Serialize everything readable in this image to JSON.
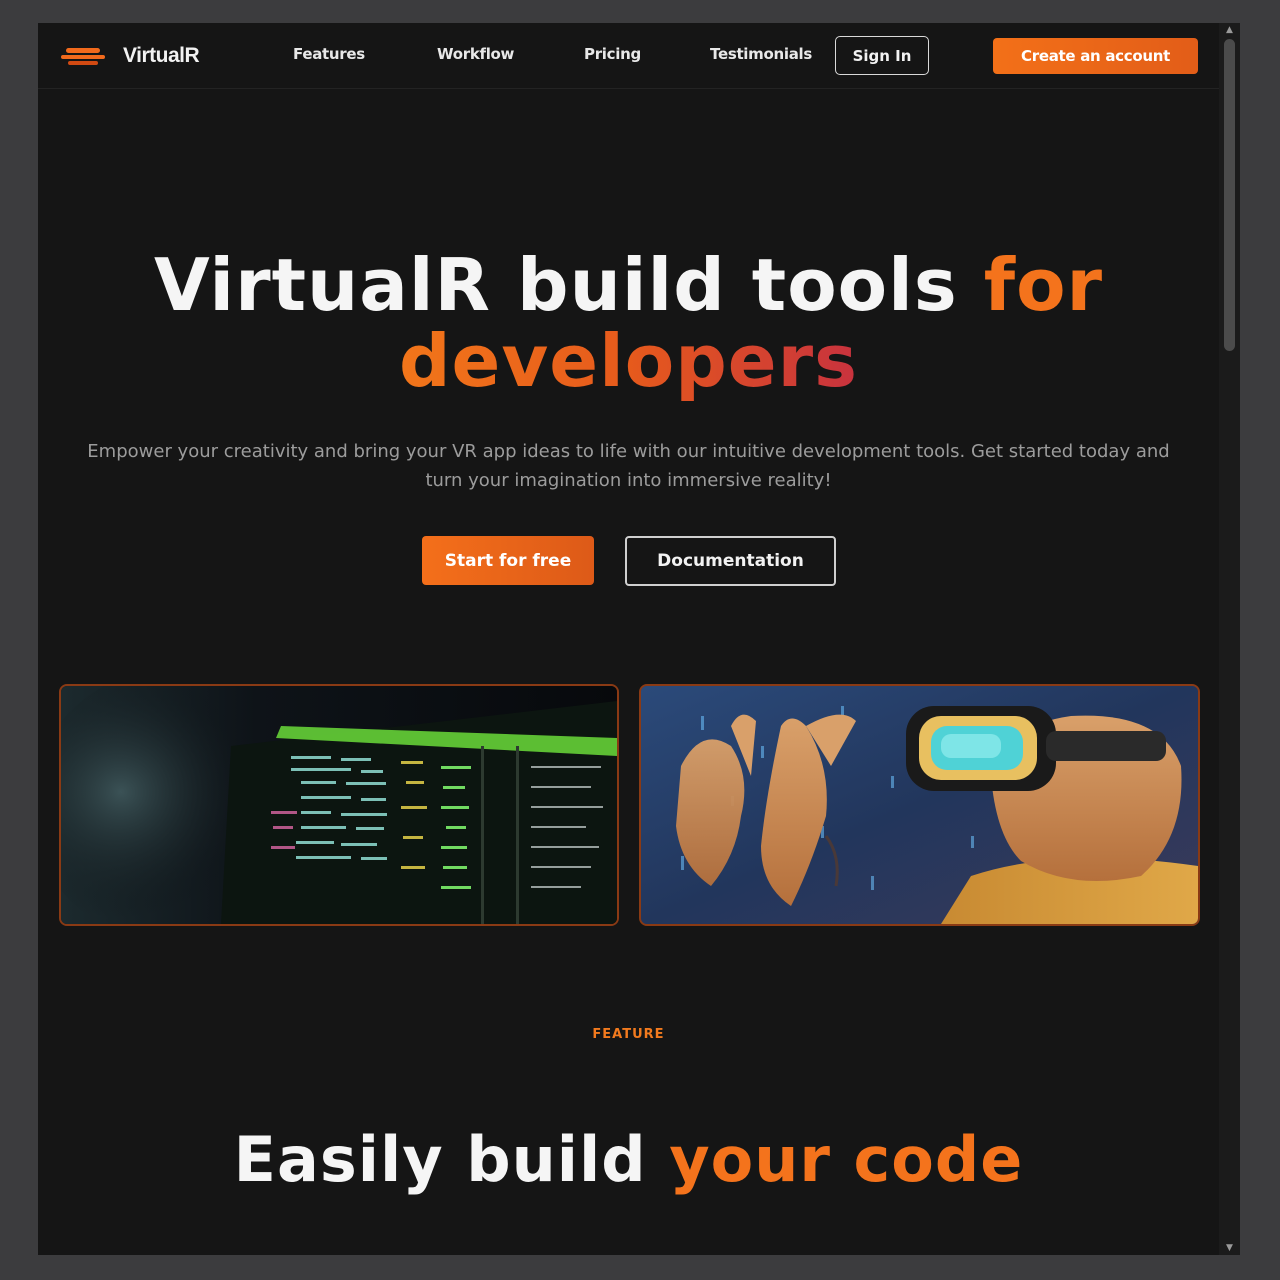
{
  "brand": {
    "name": "VirtualR"
  },
  "nav": {
    "links": [
      "Features",
      "Workflow",
      "Pricing",
      "Testimonials"
    ],
    "signin_label": "Sign In",
    "create_label": "Create an account"
  },
  "hero": {
    "title_main": "VirtualR build tools",
    "title_accent": "for",
    "title_line2": "developers",
    "subtitle": "Empower your creativity and bring your VR app ideas to life with our intuitive development tools. Get started today and turn your imagination into immersive reality!",
    "primary_cta": "Start for free",
    "secondary_cta": "Documentation"
  },
  "images": [
    {
      "name": "code-screen-image"
    },
    {
      "name": "vr-headset-image"
    }
  ],
  "feature": {
    "tag": "FEATURE",
    "title_main": "Easily build",
    "title_accent": "your code"
  },
  "colors": {
    "accent": "#f4731c",
    "background": "#151515",
    "frame": "#3c3c3e"
  }
}
